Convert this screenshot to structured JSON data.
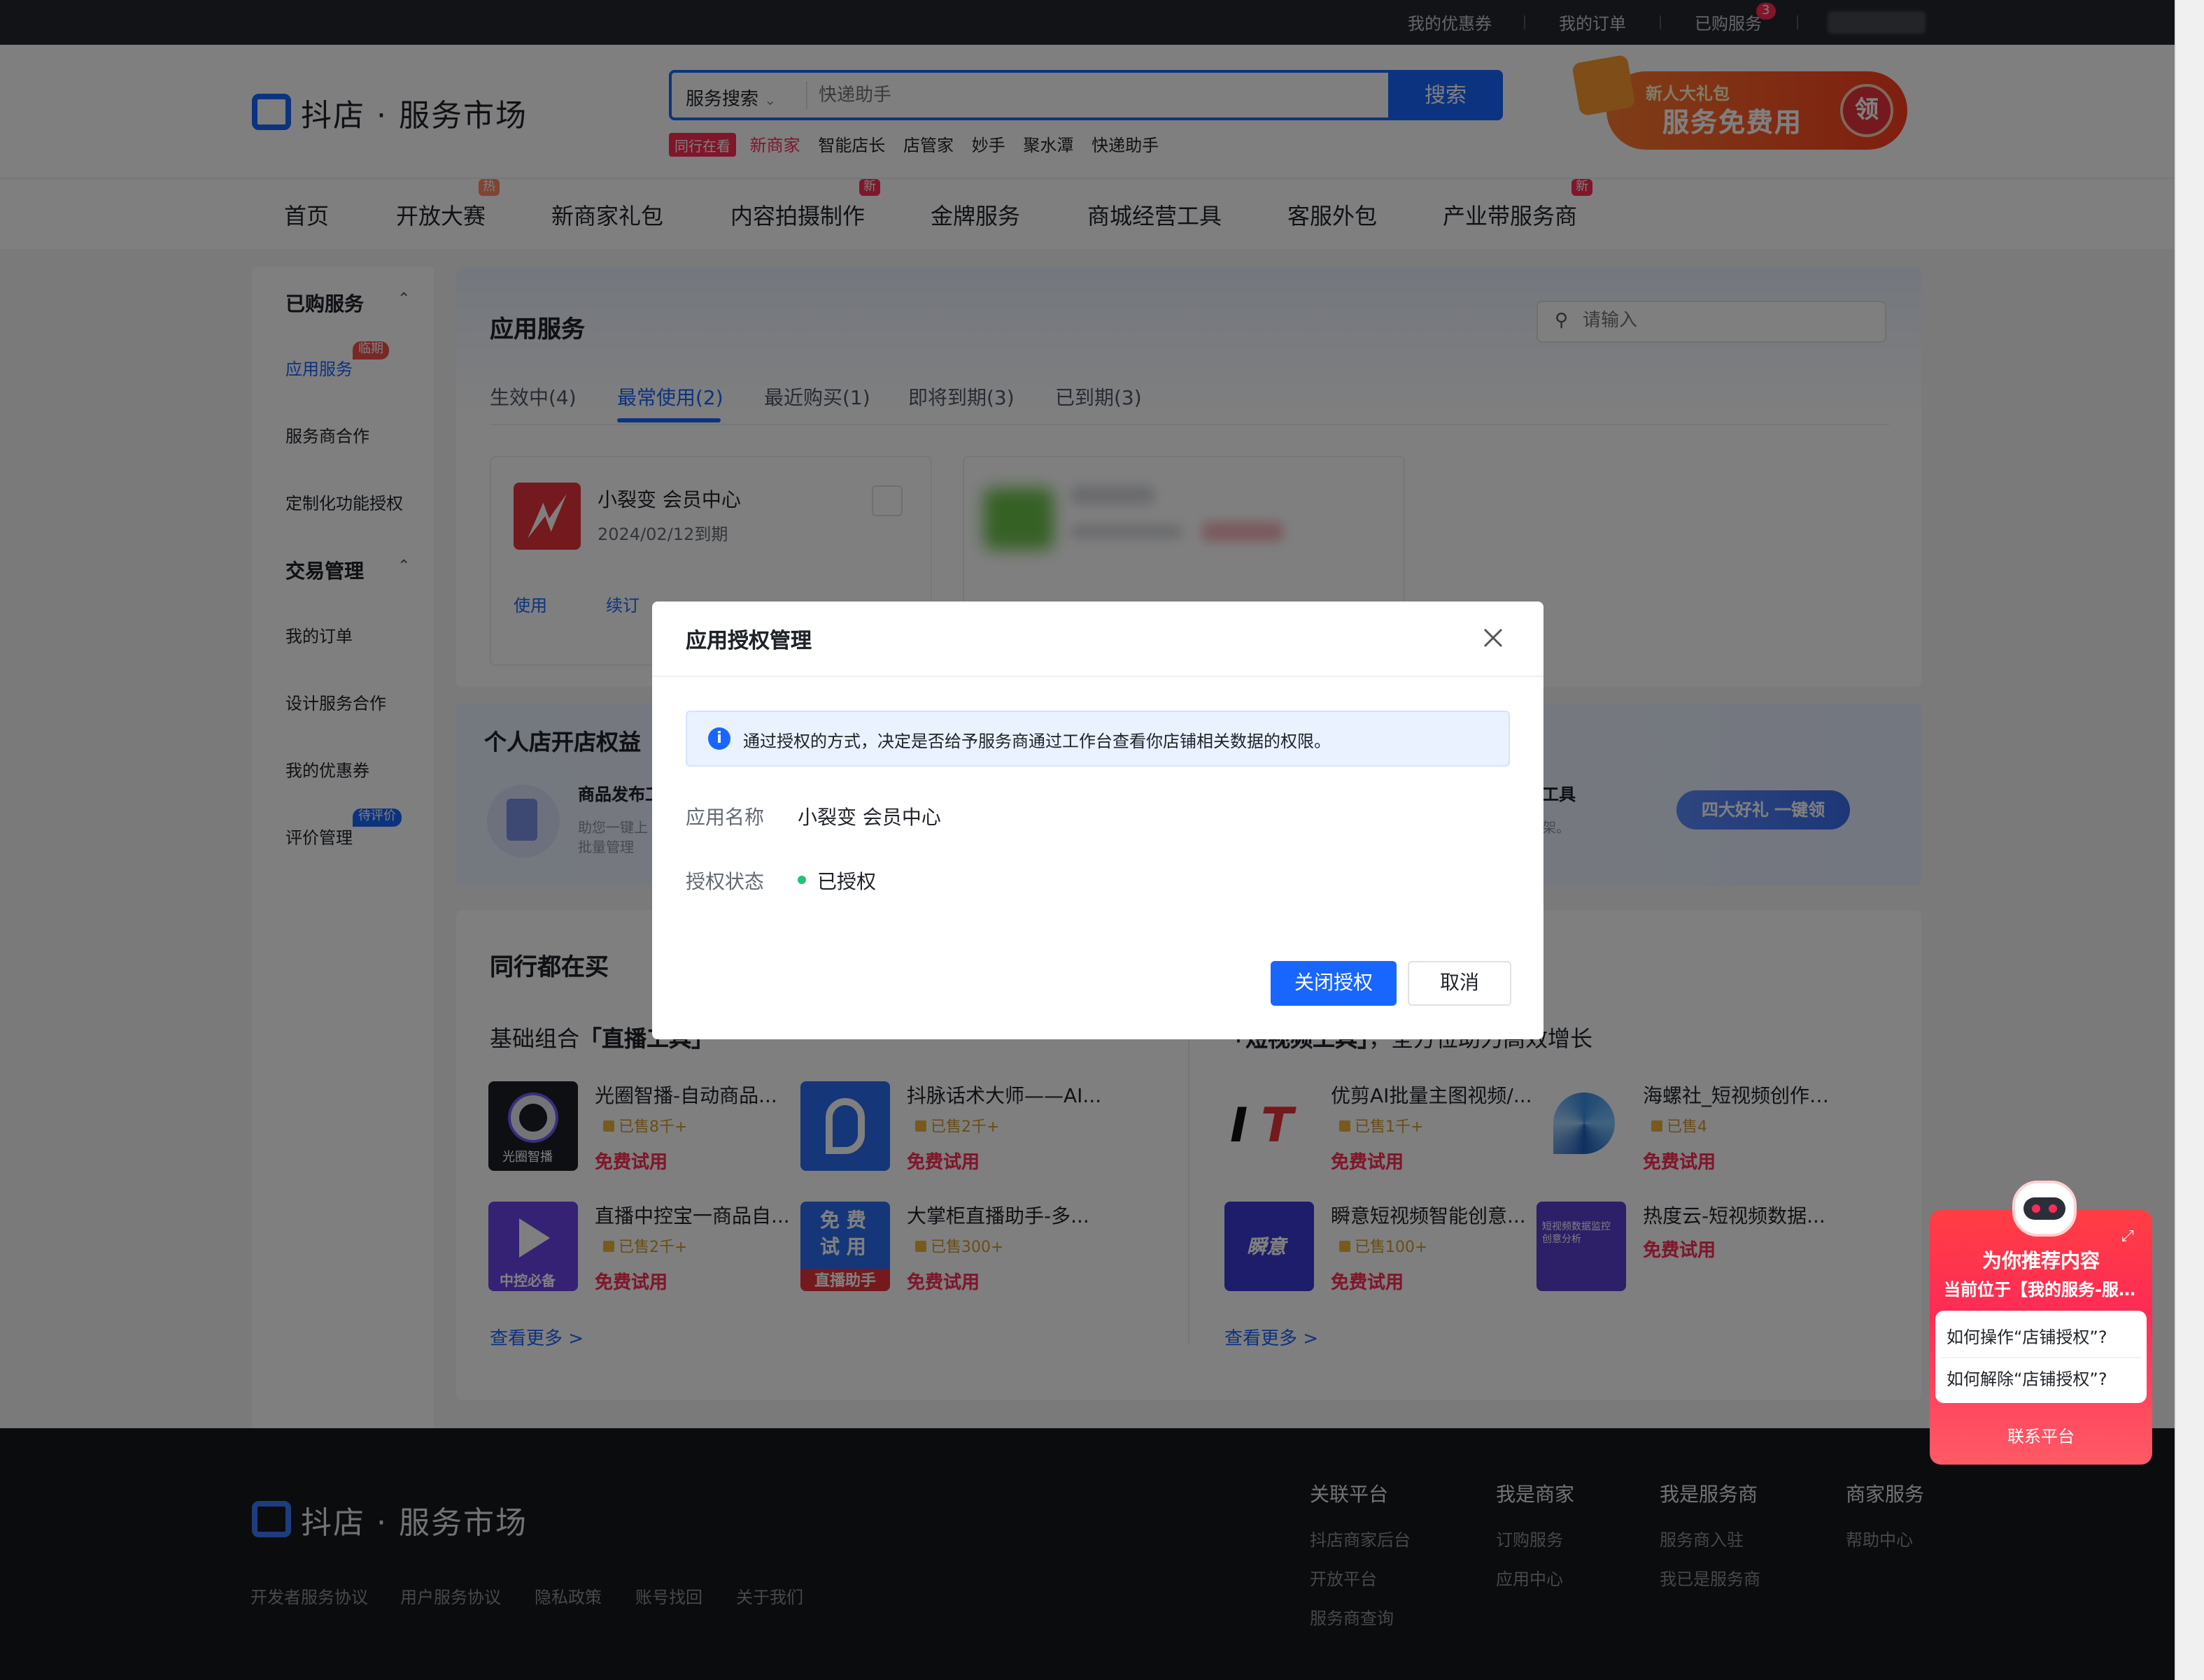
{
  "topbar": {
    "links": [
      "我的优惠券",
      "我的订单",
      "已购服务"
    ],
    "cart_badge": "3"
  },
  "header": {
    "logo_brand": "抖店",
    "logo_sep": "·",
    "logo_product": "服务市场",
    "search_type": "服务搜索",
    "search_placeholder": "快递助手",
    "search_button": "搜索",
    "hot_tag": "同行在看",
    "hot_words": [
      "新商家",
      "智能店长",
      "店管家",
      "妙手",
      "聚水潭",
      "快递助手"
    ],
    "promo_line1": "新人大礼包",
    "promo_line2": "服务免费用",
    "promo_claim": "领"
  },
  "nav": {
    "items": [
      "首页",
      "开放大赛",
      "新商家礼包",
      "内容拍摄制作",
      "金牌服务",
      "商城经营工具",
      "客服外包",
      "产业带服务商"
    ],
    "tag_hot": "热",
    "tag_new": "新"
  },
  "sidebar": {
    "section1": "已购服务",
    "items1": [
      "应用服务",
      "服务商合作",
      "定制化功能授权"
    ],
    "badge_expiring": "临期",
    "section2": "交易管理",
    "items2": [
      "我的订单",
      "设计服务合作",
      "我的优惠券",
      "评价管理"
    ],
    "badge_review": "待评价"
  },
  "app_panel": {
    "title": "应用服务",
    "search_placeholder": "请输入",
    "tabs": [
      "生效中(4)",
      "最常使用(2)",
      "最近购买(1)",
      "即将到期(3)",
      "已到期(3)"
    ],
    "active_tab": 1,
    "card": {
      "name": "小裂变 会员中心",
      "expiry": "2024/02/12到期",
      "actions": [
        "使用",
        "续订"
      ]
    }
  },
  "banner": {
    "title": "个人店开店权益",
    "item1_title": "商品发布工",
    "item1_desc1": "助您一键上",
    "item1_desc2": "批量管理",
    "item2_title": "工具",
    "item2_desc": "架。",
    "button": "四大好礼 一键领"
  },
  "peers": {
    "title": "同行都在买",
    "left_sub_prefix": "基础组合",
    "left_sub_bold": "「直播工具」",
    "right_sub_bold": "「短视频工具」",
    "right_sub_suffix": "，全方位助力高效增长",
    "products": [
      {
        "name": "光圈智播-自动商品...",
        "sold": "已售8千+",
        "price": "免费试用",
        "pic": "光圈智播"
      },
      {
        "name": "抖脉话术大师——AI...",
        "sold": "已售2千+",
        "price": "免费试用",
        "pic": ""
      },
      {
        "name": "直播中控宝一商品自...",
        "sold": "已售2千+",
        "price": "免费试用",
        "pic": "中控必备"
      },
      {
        "name": "大掌柜直播助手-多...",
        "sold": "已售300+",
        "price": "免费试用",
        "pic1": "免 费",
        "pic2": "试 用",
        "pic3": "直播助手"
      },
      {
        "name": "优剪AI批量主图视频/...",
        "sold": "已售1千+",
        "price": "免费试用",
        "pic": ""
      },
      {
        "name": "海螺社_短视频创作大师",
        "sold": "已售4",
        "price": "免费试用",
        "pic": ""
      },
      {
        "name": "瞬意短视频智能创意...",
        "sold": "已售100+",
        "price": "免费试用",
        "pic": "瞬意"
      },
      {
        "name": "热度云-短视频数据...",
        "sold": "",
        "price": "免费试用",
        "pic": "短视频数据监控 创意分析"
      }
    ],
    "more": "查看更多 >"
  },
  "footer": {
    "logo_brand": "抖店",
    "logo_sep": "·",
    "logo_product": "服务市场",
    "bottom_links": [
      "开发者服务协议",
      "用户服务协议",
      "隐私政策",
      "账号找回",
      "关于我们"
    ],
    "columns": [
      {
        "title": "关联平台",
        "links": [
          "抖店商家后台",
          "开放平台",
          "服务商查询"
        ]
      },
      {
        "title": "我是商家",
        "links": [
          "订购服务",
          "应用中心"
        ]
      },
      {
        "title": "我是服务商",
        "links": [
          "服务商入驻",
          "我已是服务商"
        ]
      },
      {
        "title": "商家服务",
        "links": [
          "帮助中心"
        ]
      }
    ]
  },
  "modal": {
    "title": "应用授权管理",
    "info": "通过授权的方式，决定是否给予服务商通过工作台查看你店铺相关数据的权限。",
    "app_label": "应用名称",
    "app_value": "小裂变 会员中心",
    "status_label": "授权状态",
    "status_value": "已授权",
    "primary_button": "关闭授权",
    "cancel_button": "取消"
  },
  "recommend": {
    "title": "为你推荐内容",
    "subtitle": "当前位于【我的服务-服务授权】",
    "questions": [
      "如何操作“店铺授权”?",
      "如何解除“店铺授权”?"
    ],
    "contact": "联系平台"
  },
  "colors": {
    "brand_blue": "#1966ff",
    "danger_red": "#fe2c55",
    "success_green": "#22c37a"
  }
}
